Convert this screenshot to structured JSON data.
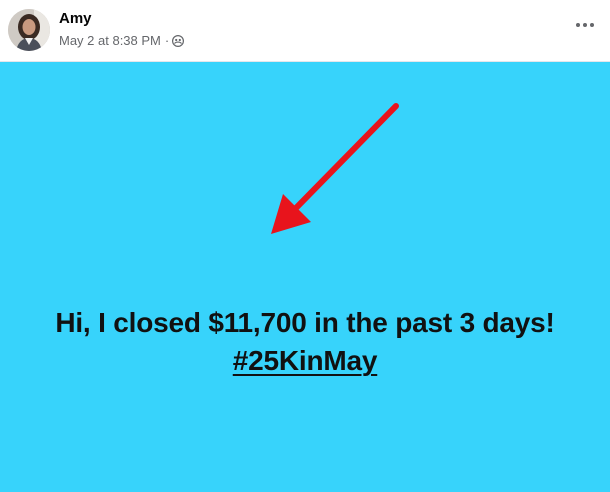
{
  "post": {
    "author": {
      "name": "Amy"
    },
    "timestamp": "May 2 at 8:38 PM",
    "separator": "·",
    "audience_icon": "friends-globe-icon",
    "more_icon": "more-horizontal-icon",
    "content": {
      "background_color": "#37d3fb",
      "line1": "Hi, I closed $11,700 in the past 3 days!",
      "hashtag": "#25KinMay",
      "annotation": {
        "type": "arrow",
        "color": "#e8141c"
      }
    }
  }
}
